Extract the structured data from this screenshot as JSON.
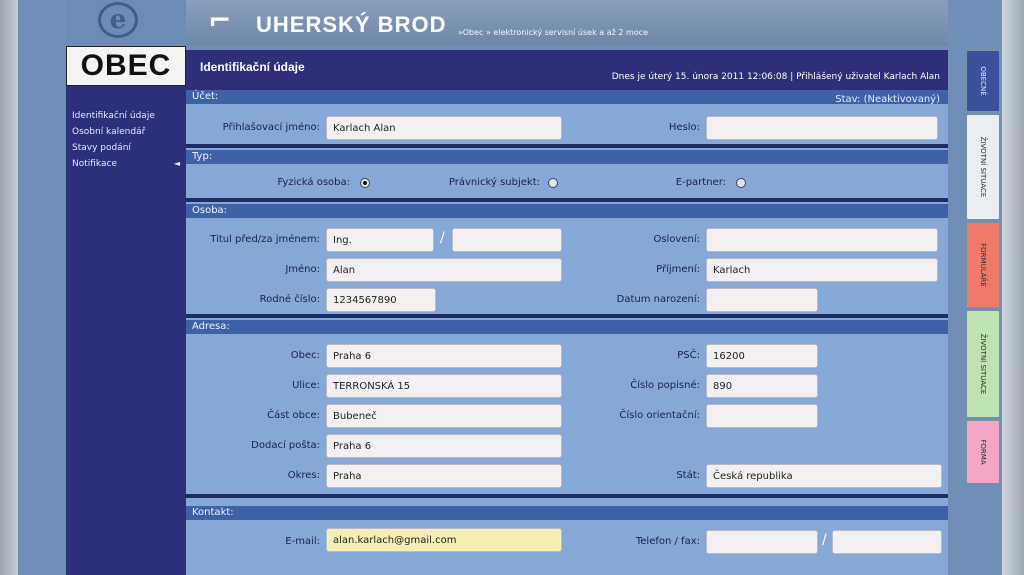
{
  "header": {
    "brand_icon": "⌐",
    "brand_title": "UHERSKÝ BROD",
    "brand_subtitle": "»Obec » elektronický servisní úsek a až 2 moce",
    "logo_letter": "e",
    "obec_label": "OBEC"
  },
  "leftnav": {
    "items": [
      {
        "label": "Identifikační údaje"
      },
      {
        "label": "Osobní kalendář"
      },
      {
        "label": "Stavy podání"
      },
      {
        "label": "Notifikace",
        "arrow": "◄"
      }
    ]
  },
  "titlebar": {
    "title": "Identifikační údaje",
    "datetime": "Dnes je úterý 15. února 2011 12:06:08 | Přihlášený uživatel Karlach Alan"
  },
  "sections": {
    "ucet": "Účet:",
    "typ": "Typ:",
    "osoba": "Osoba:",
    "adresa": "Adresa:",
    "kontakt": "Kontakt:"
  },
  "ucet": {
    "state_label": "Stav: (Neaktivovaný)",
    "login_label": "Přihlašovací jméno:",
    "login_value": "Karlach Alan",
    "password_label": "Heslo:",
    "password_value": ""
  },
  "typ": {
    "fyzicka_label": "Fyzická osoba:",
    "pravnicky_label": "Právnický subjekt:",
    "epartner_label": "E-partner:",
    "selected": "fyzicka"
  },
  "osoba": {
    "titul_label": "Titul před/za jménem:",
    "titul_pred": "Ing.",
    "titul_za": "",
    "oslovení_label": "Oslovení:",
    "osloveni_value": "",
    "jmeno_label": "Jméno:",
    "jmeno_value": "Alan",
    "prijmeni_label": "Příjmení:",
    "prijmeni_value": "Karlach",
    "rodne_label": "Rodné číslo:",
    "rodne_value": "1234567890",
    "datum_label": "Datum narození:",
    "datum_value": ""
  },
  "adresa": {
    "obec_label": "Obec:",
    "obec_value": "Praha 6",
    "psc_label": "PSČ:",
    "psc_value": "16200",
    "ulice_label": "Ulice:",
    "ulice_value": "TERRONSKÁ 15",
    "cp_label": "Číslo popisné:",
    "cp_value": "890",
    "cast_label": "Část obce:",
    "cast_value": "Bubeneč",
    "co_label": "Číslo orientační:",
    "co_value": "",
    "posta_label": "Dodací pošta:",
    "posta_value": "Praha 6",
    "okres_label": "Okres:",
    "okres_value": "Praha",
    "stat_label": "Stát:",
    "stat_value": "Česká republika"
  },
  "kontakt": {
    "email_label": "E-mail:",
    "email_value": "alan.karlach@gmail.com",
    "tel_label": "Telefon / fax:",
    "tel_value": "",
    "fax_value": ""
  },
  "right_tabs": [
    {
      "label": "OBECNÉ",
      "color": "#3b4f9a"
    },
    {
      "label": "ŽIVOTNÍ SITUACE",
      "color": "#e8eef2"
    },
    {
      "label": "FORMULÁŘE",
      "color": "#f07a6a"
    },
    {
      "label": "ŽIVOTNÍ SITUACE",
      "color": "#bfe2b2"
    },
    {
      "label": "FORMA",
      "color": "#f4a6c6"
    }
  ],
  "colors": {
    "nav_bg": "#2c2f7a",
    "panel_bg": "#86a8d6",
    "section_bar": "#3d62a8",
    "email_highlight": "#f5efb5"
  }
}
